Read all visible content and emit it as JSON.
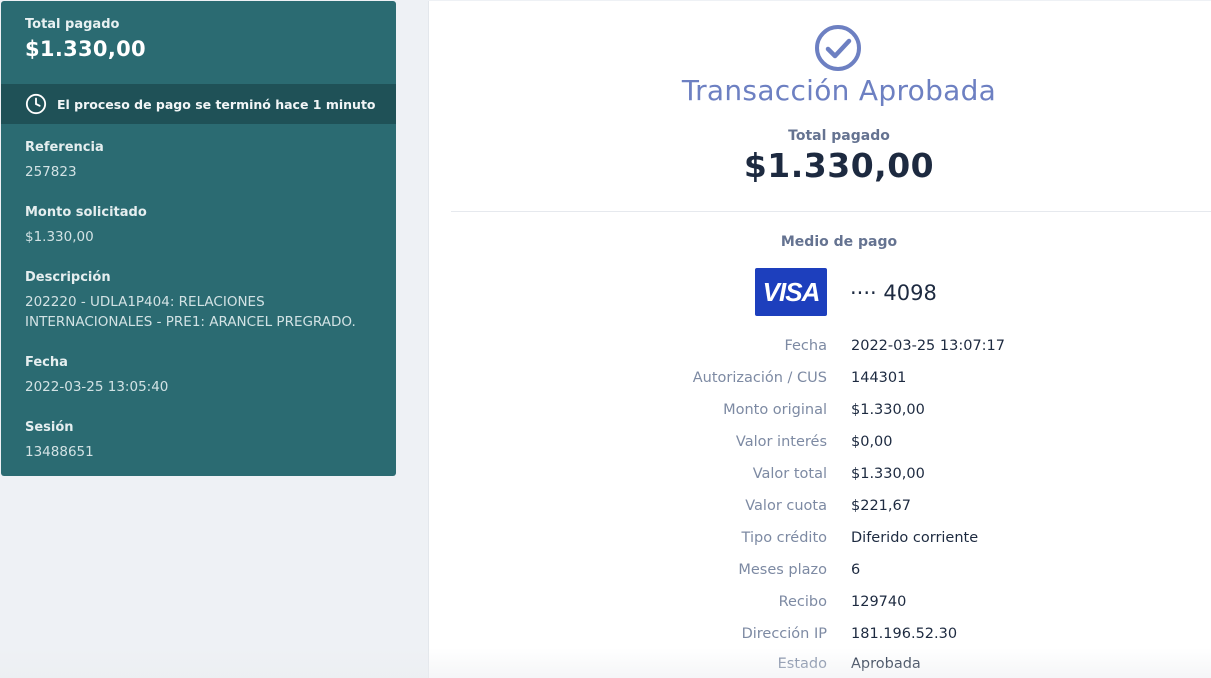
{
  "summary": {
    "total_label": "Total pagado",
    "total_amount": "$1.330,00",
    "status_text": "El proceso de pago se terminó hace 1 minuto",
    "fields": [
      {
        "label": "Referencia",
        "value": "257823"
      },
      {
        "label": "Monto solicitado",
        "value": "$1.330,00"
      },
      {
        "label": "Descripción",
        "value": "202220 - UDLA1P404: RELACIONES INTERNACIONALES - PRE1: ARANCEL PREGRADO."
      },
      {
        "label": "Fecha",
        "value": "2022-03-25 13:05:40"
      },
      {
        "label": "Sesión",
        "value": "13488651"
      }
    ]
  },
  "receipt": {
    "icon": "check-circle-icon",
    "title": "Transacción Aprobada",
    "total_label": "Total pagado",
    "total_amount": "$1.330,00",
    "payment_method_label": "Medio de pago",
    "card_brand": "VISA",
    "card_number": "···· 4098",
    "details": [
      {
        "label": "Fecha",
        "value": "2022-03-25 13:07:17"
      },
      {
        "label": "Autorización / CUS",
        "value": "144301"
      },
      {
        "label": "Monto original",
        "value": "$1.330,00"
      },
      {
        "label": "Valor interés",
        "value": "$0,00"
      },
      {
        "label": "Valor total",
        "value": "$1.330,00"
      },
      {
        "label": "Valor cuota",
        "value": "$221,67"
      },
      {
        "label": "Tipo crédito",
        "value": "Diferido corriente"
      },
      {
        "label": "Meses plazo",
        "value": "6"
      },
      {
        "label": "Recibo",
        "value": "129740"
      },
      {
        "label": "Dirección IP",
        "value": "181.196.52.30"
      },
      {
        "label": "Estado",
        "value": "Aprobada"
      }
    ]
  },
  "colors": {
    "sidebar": "#2b6b72",
    "sidebar_status": "#1f5157",
    "accent": "#6d80c2",
    "visa": "#1d3fbd"
  }
}
